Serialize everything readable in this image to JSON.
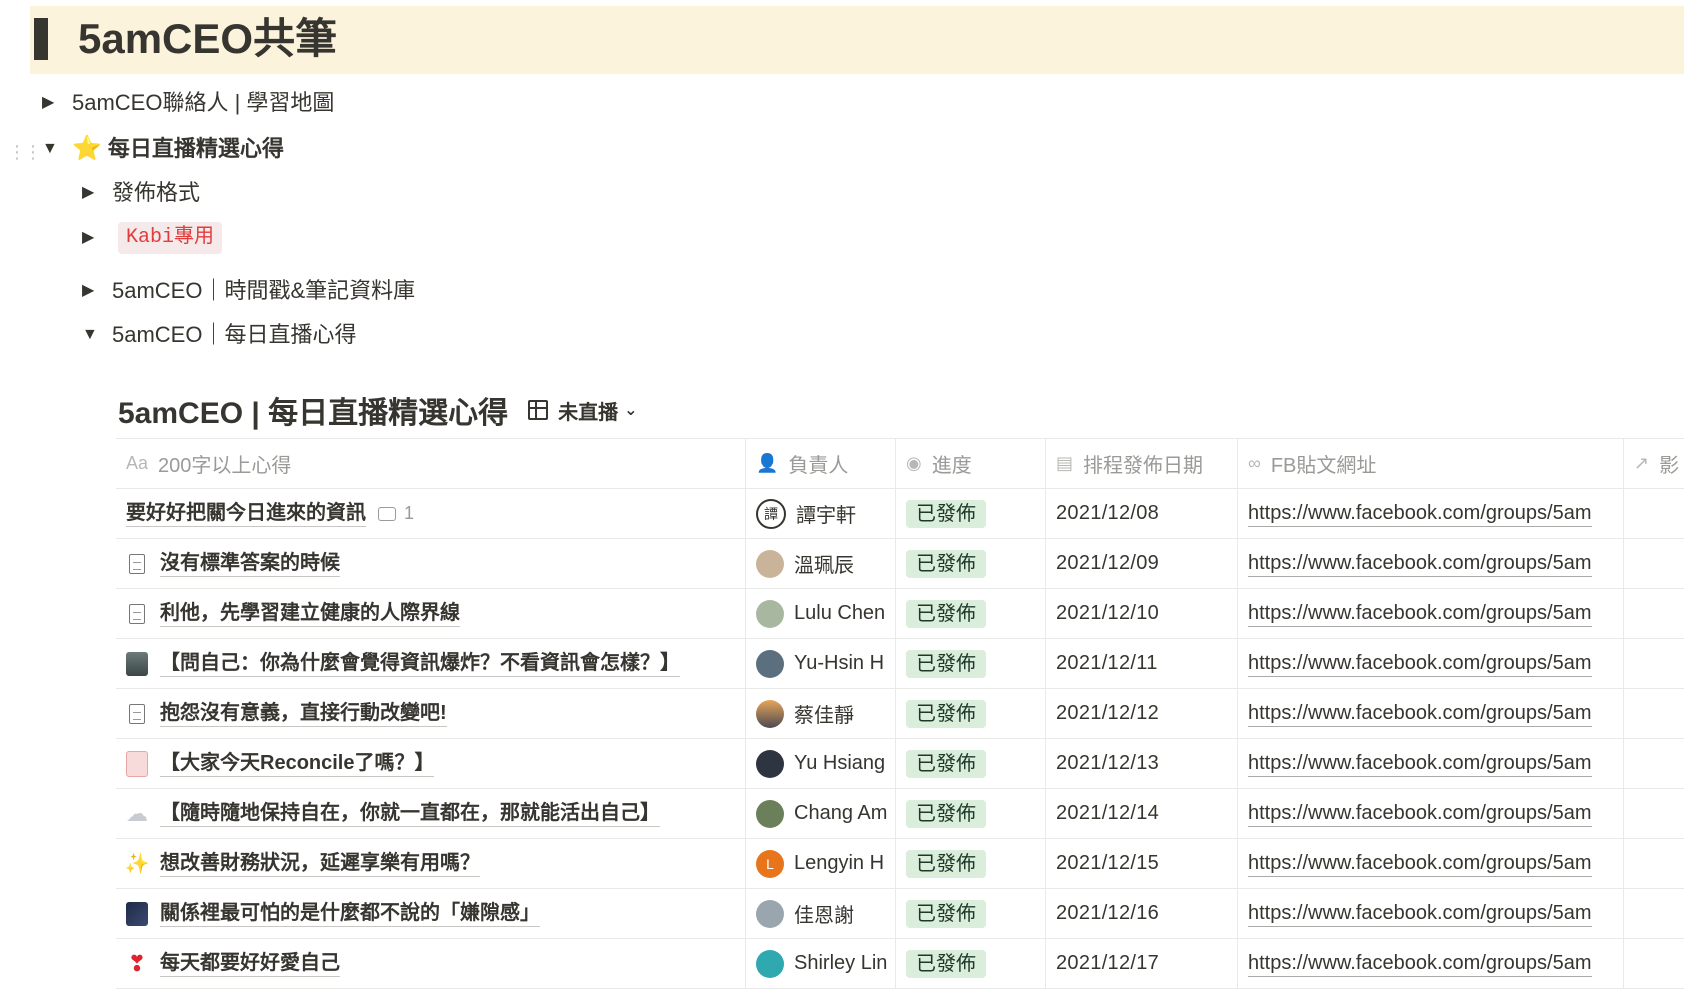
{
  "banner_title": "5amCEO共筆",
  "toggles": {
    "contacts": "5amCEO聯絡人 | 學習地圖",
    "daily": "每日直播精選心得",
    "format": "發佈格式",
    "kabi": "Kabi專用",
    "timestamps": "5amCEO｜時間戳&筆記資料庫",
    "daily_notes": "5amCEO｜每日直播心得"
  },
  "database": {
    "title": "5amCEO | 每日直播精選心得",
    "view_label": "未直播"
  },
  "columns": {
    "name": "200字以上心得",
    "owner": "負責人",
    "progress": "進度",
    "date": "排程發佈日期",
    "fb": "FB貼文網址",
    "extra": "影"
  },
  "header_icons": {
    "name": "Aa",
    "owner": "people-icon",
    "progress": "status-icon",
    "date": "calendar-icon",
    "fb": "link-icon",
    "extra": "arrow-icon"
  },
  "rows": [
    {
      "title": "要好好把關今日進來的資訊",
      "comments": "1",
      "owner": "譚宇軒",
      "status": "已發佈",
      "date": "2021/12/08",
      "url": "https://www.facebook.com/groups/5am"
    },
    {
      "title": "沒有標準答案的時候",
      "owner": "溫珮辰",
      "status": "已發佈",
      "date": "2021/12/09",
      "url": "https://www.facebook.com/groups/5am"
    },
    {
      "title": "利他，先學習建立健康的人際界線",
      "owner": "Lulu Chen",
      "status": "已發佈",
      "date": "2021/12/10",
      "url": "https://www.facebook.com/groups/5am"
    },
    {
      "title": "【問自己：你為什麼會覺得資訊爆炸？不看資訊會怎樣？】",
      "owner": "Yu-Hsin H",
      "status": "已發佈",
      "date": "2021/12/11",
      "url": "https://www.facebook.com/groups/5am"
    },
    {
      "title": "抱怨沒有意義，直接行動改變吧!",
      "owner": "蔡佳靜",
      "status": "已發佈",
      "date": "2021/12/12",
      "url": "https://www.facebook.com/groups/5am"
    },
    {
      "title": "【大家今天Reconcile了嗎？】",
      "owner": "Yu Hsiang",
      "status": "已發佈",
      "date": "2021/12/13",
      "url": "https://www.facebook.com/groups/5am"
    },
    {
      "title": "【隨時隨地保持自在，你就一直都在，那就能活出自己】",
      "owner": "Chang Am",
      "status": "已發佈",
      "date": "2021/12/14",
      "url": "https://www.facebook.com/groups/5am"
    },
    {
      "title": "想改善財務狀況，延遲享樂有用嗎？",
      "owner": "Lengyin H",
      "avatar_letter": "L",
      "status": "已發佈",
      "date": "2021/12/15",
      "url": "https://www.facebook.com/groups/5am"
    },
    {
      "title": "關係裡最可怕的是什麼都不說的「嫌隙感」",
      "owner": "佳恩謝",
      "status": "已發佈",
      "date": "2021/12/16",
      "url": "https://www.facebook.com/groups/5am"
    },
    {
      "title": "每天都要好好愛自己",
      "owner": "Shirley Lin",
      "status": "已發佈",
      "date": "2021/12/17",
      "url": "https://www.facebook.com/groups/5am"
    }
  ],
  "avatar_badge": "譚",
  "colors": {
    "banner": "#fbf3db",
    "status_bg": "#dbeddb",
    "kabi_text": "#e03e3e"
  }
}
